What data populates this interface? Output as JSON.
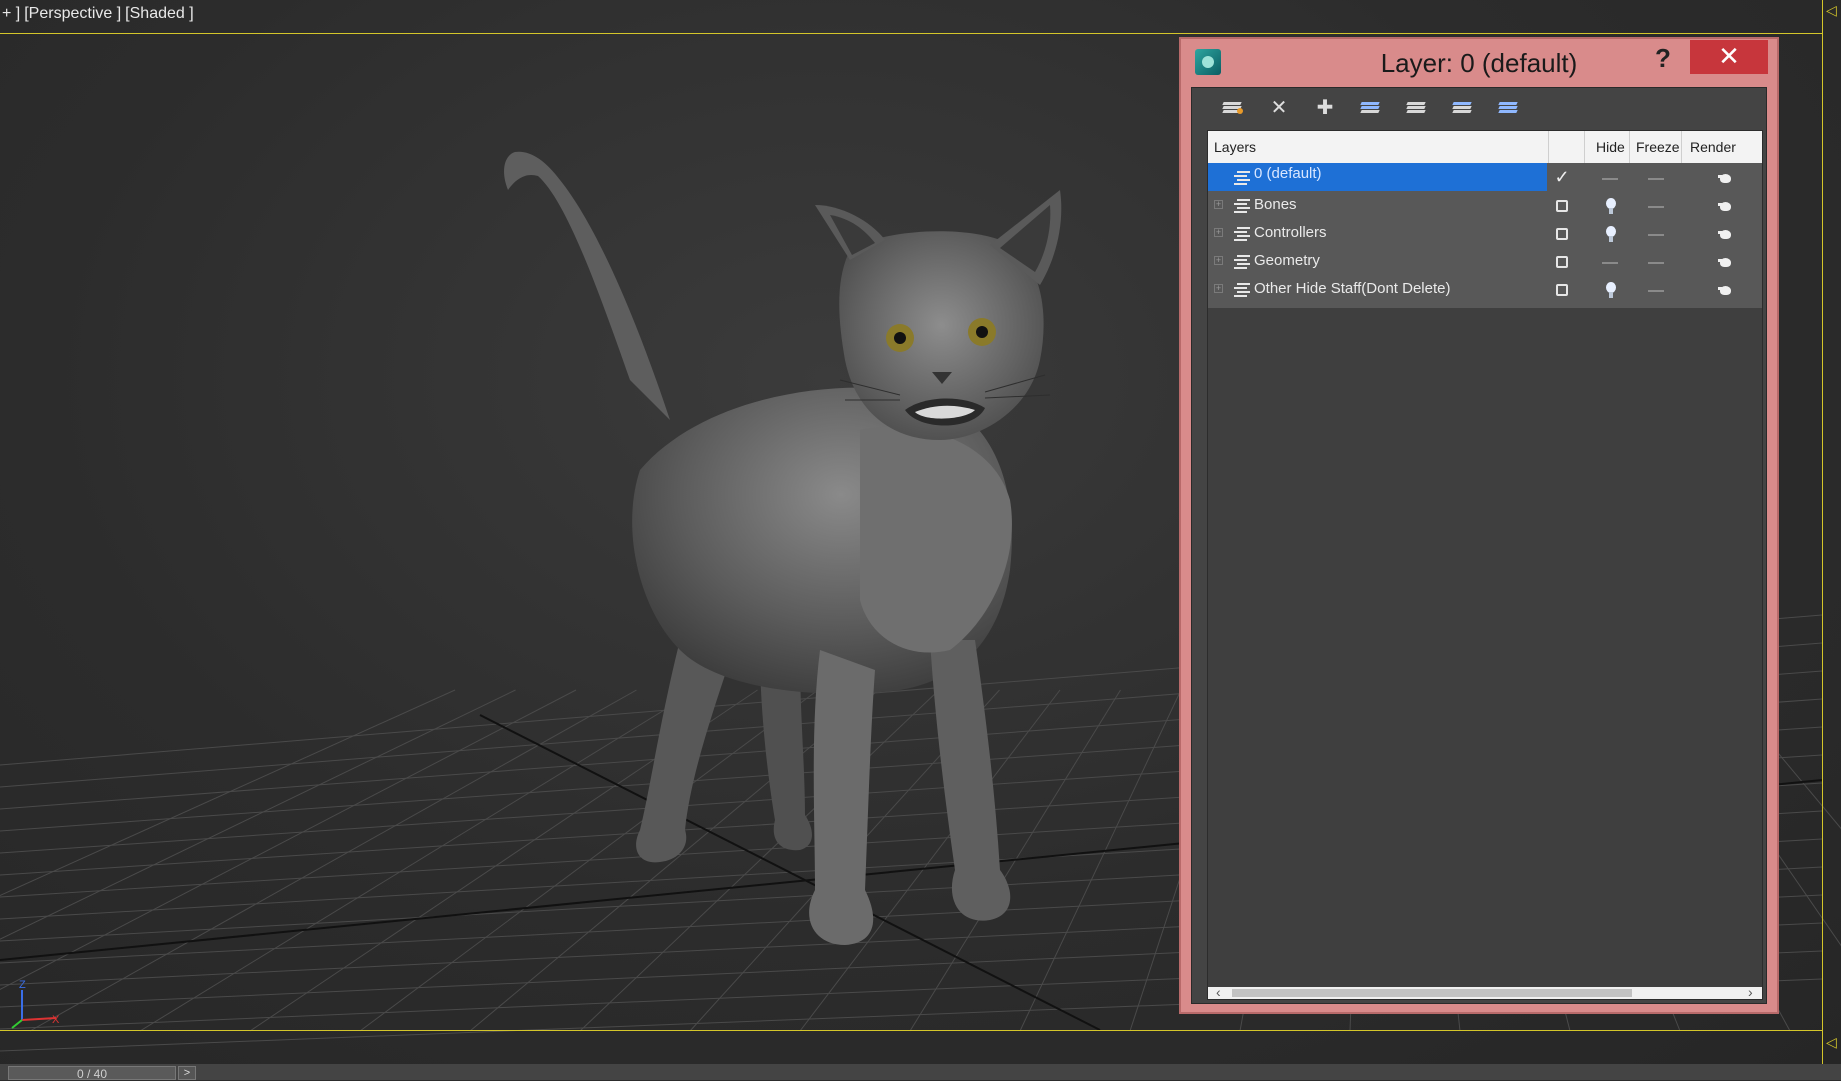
{
  "viewport": {
    "label_parts": [
      "+ ]",
      "[Perspective ]",
      "[Shaded ]"
    ],
    "axis_labels": [
      "Z",
      "X"
    ]
  },
  "timeline": {
    "frame_readout": "0 / 40",
    "next_label": ">"
  },
  "dialog": {
    "title": "Layer: 0 (default)",
    "help_label": "?",
    "close_label": "✕",
    "toolbar": [
      {
        "name": "create-new-layer-icon"
      },
      {
        "name": "delete-layer-icon",
        "glyph": "✕"
      },
      {
        "name": "add-to-layer-icon",
        "glyph": "✚"
      },
      {
        "name": "select-objects-in-layer-icon"
      },
      {
        "name": "highlight-selected-layer-icon"
      },
      {
        "name": "hide-all-layers-icon"
      },
      {
        "name": "freeze-all-layers-icon"
      }
    ],
    "columns": {
      "layers": "Layers",
      "hide": "Hide",
      "freeze": "Freeze",
      "render": "Render"
    },
    "layers": [
      {
        "name": "0 (default)",
        "current": true,
        "hidden": false,
        "expandable": false
      },
      {
        "name": "Bones",
        "current": false,
        "hidden": true,
        "expandable": true
      },
      {
        "name": "Controllers",
        "current": false,
        "hidden": true,
        "expandable": true
      },
      {
        "name": "Geometry",
        "current": false,
        "hidden": false,
        "expandable": true
      },
      {
        "name": "Other Hide Staff(Dont Delete)",
        "current": false,
        "hidden": true,
        "expandable": true
      }
    ],
    "scroll": {
      "left": "‹",
      "right": "›"
    }
  },
  "colors": {
    "viewport_border": "#d4c62a",
    "dialog_frame": "#d98b8b",
    "close_button": "#c7363c",
    "selection": "#1e70d6"
  }
}
